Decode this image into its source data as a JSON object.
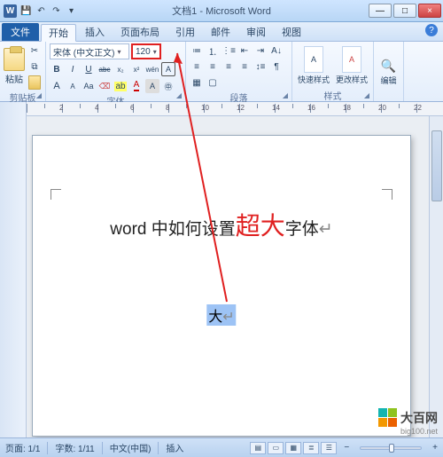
{
  "window": {
    "title": "文档1 - Microsoft Word",
    "min": "—",
    "max": "□",
    "close": "×"
  },
  "qat": {
    "save": "💾",
    "undo": "↶",
    "redo": "↷",
    "more": "▾"
  },
  "tabs": {
    "file": "文件",
    "items": [
      "开始",
      "插入",
      "页面布局",
      "引用",
      "邮件",
      "审阅",
      "视图"
    ],
    "active": 0
  },
  "ribbon": {
    "clipboard": {
      "paste": "粘贴",
      "label": "剪贴板"
    },
    "font": {
      "name": "宋体 (中文正文)",
      "size": "120",
      "label": "字体",
      "btns": {
        "b": "B",
        "i": "I",
        "u": "U",
        "s": "abc",
        "sub": "x₂",
        "sup": "x²",
        "grow": "A",
        "shrink": "A",
        "clear": "Aa",
        "phonetic": "wén",
        "charborder": "A",
        "highlight": "ab",
        "color": "A",
        "caseChange": "Aa"
      }
    },
    "paragraph": {
      "label": "段落"
    },
    "styles": {
      "quick": "快速样式",
      "change": "更改样式",
      "label": "样式"
    },
    "editing": {
      "label": "编辑"
    }
  },
  "document": {
    "line_pre": "word 中如何设置",
    "line_red": "超大",
    "line_post": "字体",
    "selected": "大"
  },
  "status": {
    "page": "页面: 1/1",
    "words": "字数: 1/11",
    "lang": "中文(中国)",
    "mode": "插入",
    "zoom_minus": "−",
    "zoom_plus": "+",
    "zoom_pct": "100%"
  },
  "branding": {
    "name": "大百网",
    "url": "big100.net"
  }
}
